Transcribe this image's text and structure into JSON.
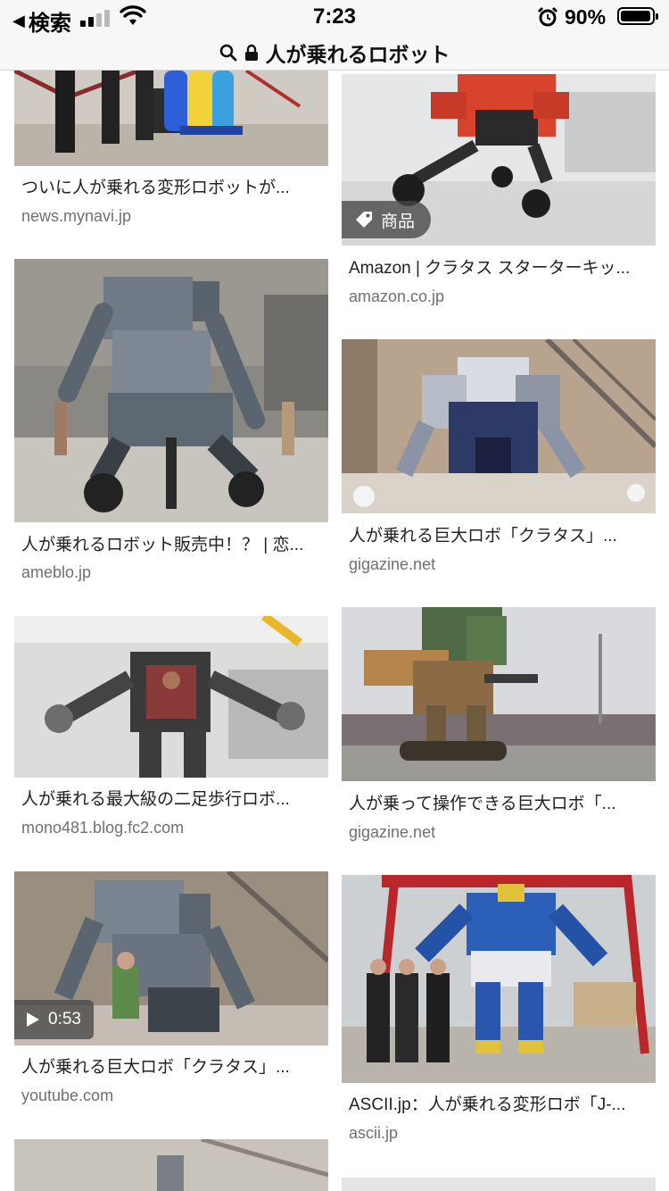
{
  "status": {
    "back_label": "検索",
    "time": "7:23",
    "battery": "90%",
    "battery_level": 0.9,
    "signal_bars": 2
  },
  "url_bar": {
    "query": "人が乗れるロボット"
  },
  "results": [
    {
      "title": "ついに人が乗れる変形ロボットが...",
      "domain": "news.mynavi.jp"
    },
    {
      "title": "Amazon | クラタス スターターキッ...",
      "domain": "amazon.co.jp",
      "badge": "商品"
    },
    {
      "title": "人が乗れるロボット販売中！？ | 恋...",
      "domain": "ameblo.jp"
    },
    {
      "title": "人が乗れる巨大ロボ「クラタス」...",
      "domain": "gigazine.net"
    },
    {
      "title": "人が乗れる最大級の二足歩行ロボ...",
      "domain": "mono481.blog.fc2.com"
    },
    {
      "title": "人が乗って操作できる巨大ロボ「...",
      "domain": "gigazine.net"
    },
    {
      "title": "人が乗れる巨大ロボ「クラタス」...",
      "domain": "youtube.com",
      "video_duration": "0:53"
    },
    {
      "title": "ASCII.jp：人が乗れる変形ロボ「J-...",
      "domain": "ascii.jp"
    }
  ],
  "colors": {
    "chrome_bg": "#f7f7f7",
    "domain_text": "#707070",
    "badge_bg": "#464646"
  }
}
